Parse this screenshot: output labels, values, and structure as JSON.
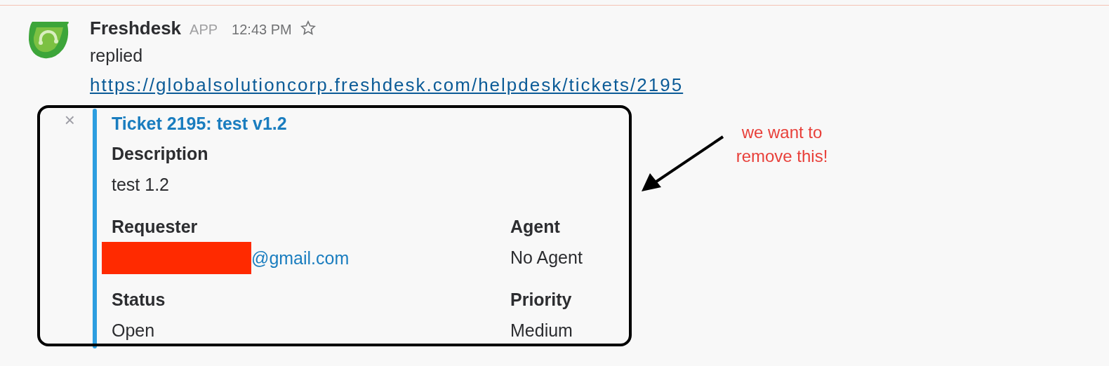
{
  "message": {
    "sender": "Freshdesk",
    "badge": "APP",
    "time": "12:43 PM",
    "starred": false,
    "text": "replied",
    "link": "https://globalsolutioncorp.freshdesk.com/helpdesk/tickets/2195"
  },
  "attachment": {
    "close": "×",
    "title": "Ticket 2195: test v1.2",
    "fields": [
      {
        "title": "Description",
        "value": "test 1.2",
        "short": false,
        "redacted": false,
        "kind": "text"
      },
      {
        "title": "Requester",
        "value": "@gmail.com",
        "short": true,
        "redacted": true,
        "kind": "link"
      },
      {
        "title": "Agent",
        "value": "No Agent",
        "short": true,
        "redacted": false,
        "kind": "text"
      },
      {
        "title": "Status",
        "value": "Open",
        "short": true,
        "redacted": false,
        "kind": "text"
      },
      {
        "title": "Priority",
        "value": "Medium",
        "short": true,
        "redacted": false,
        "kind": "text"
      }
    ]
  },
  "annotation": {
    "text": "we want to remove this!"
  }
}
